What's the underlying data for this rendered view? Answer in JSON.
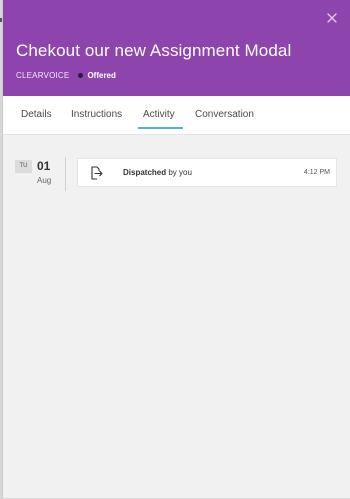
{
  "modal": {
    "title": "Chekout our new Assignment Modal",
    "company": "CLEARVOICE",
    "status": "Offered"
  },
  "tabs": [
    {
      "label": "Details"
    },
    {
      "label": "Instructions"
    },
    {
      "label": "Activity",
      "active": true
    },
    {
      "label": "Conversation"
    }
  ],
  "activity": {
    "day_abbr": "TU",
    "day_num": "01",
    "month": "Aug",
    "entries": [
      {
        "action": "Dispatched",
        "actor": "by you",
        "time": "4:12 PM",
        "icon": "dispatch-icon"
      }
    ]
  },
  "colors": {
    "header_bg": "#8e44ad",
    "tab_active_underline": "#53b7c0",
    "status_dot": "#2c1a3a"
  }
}
